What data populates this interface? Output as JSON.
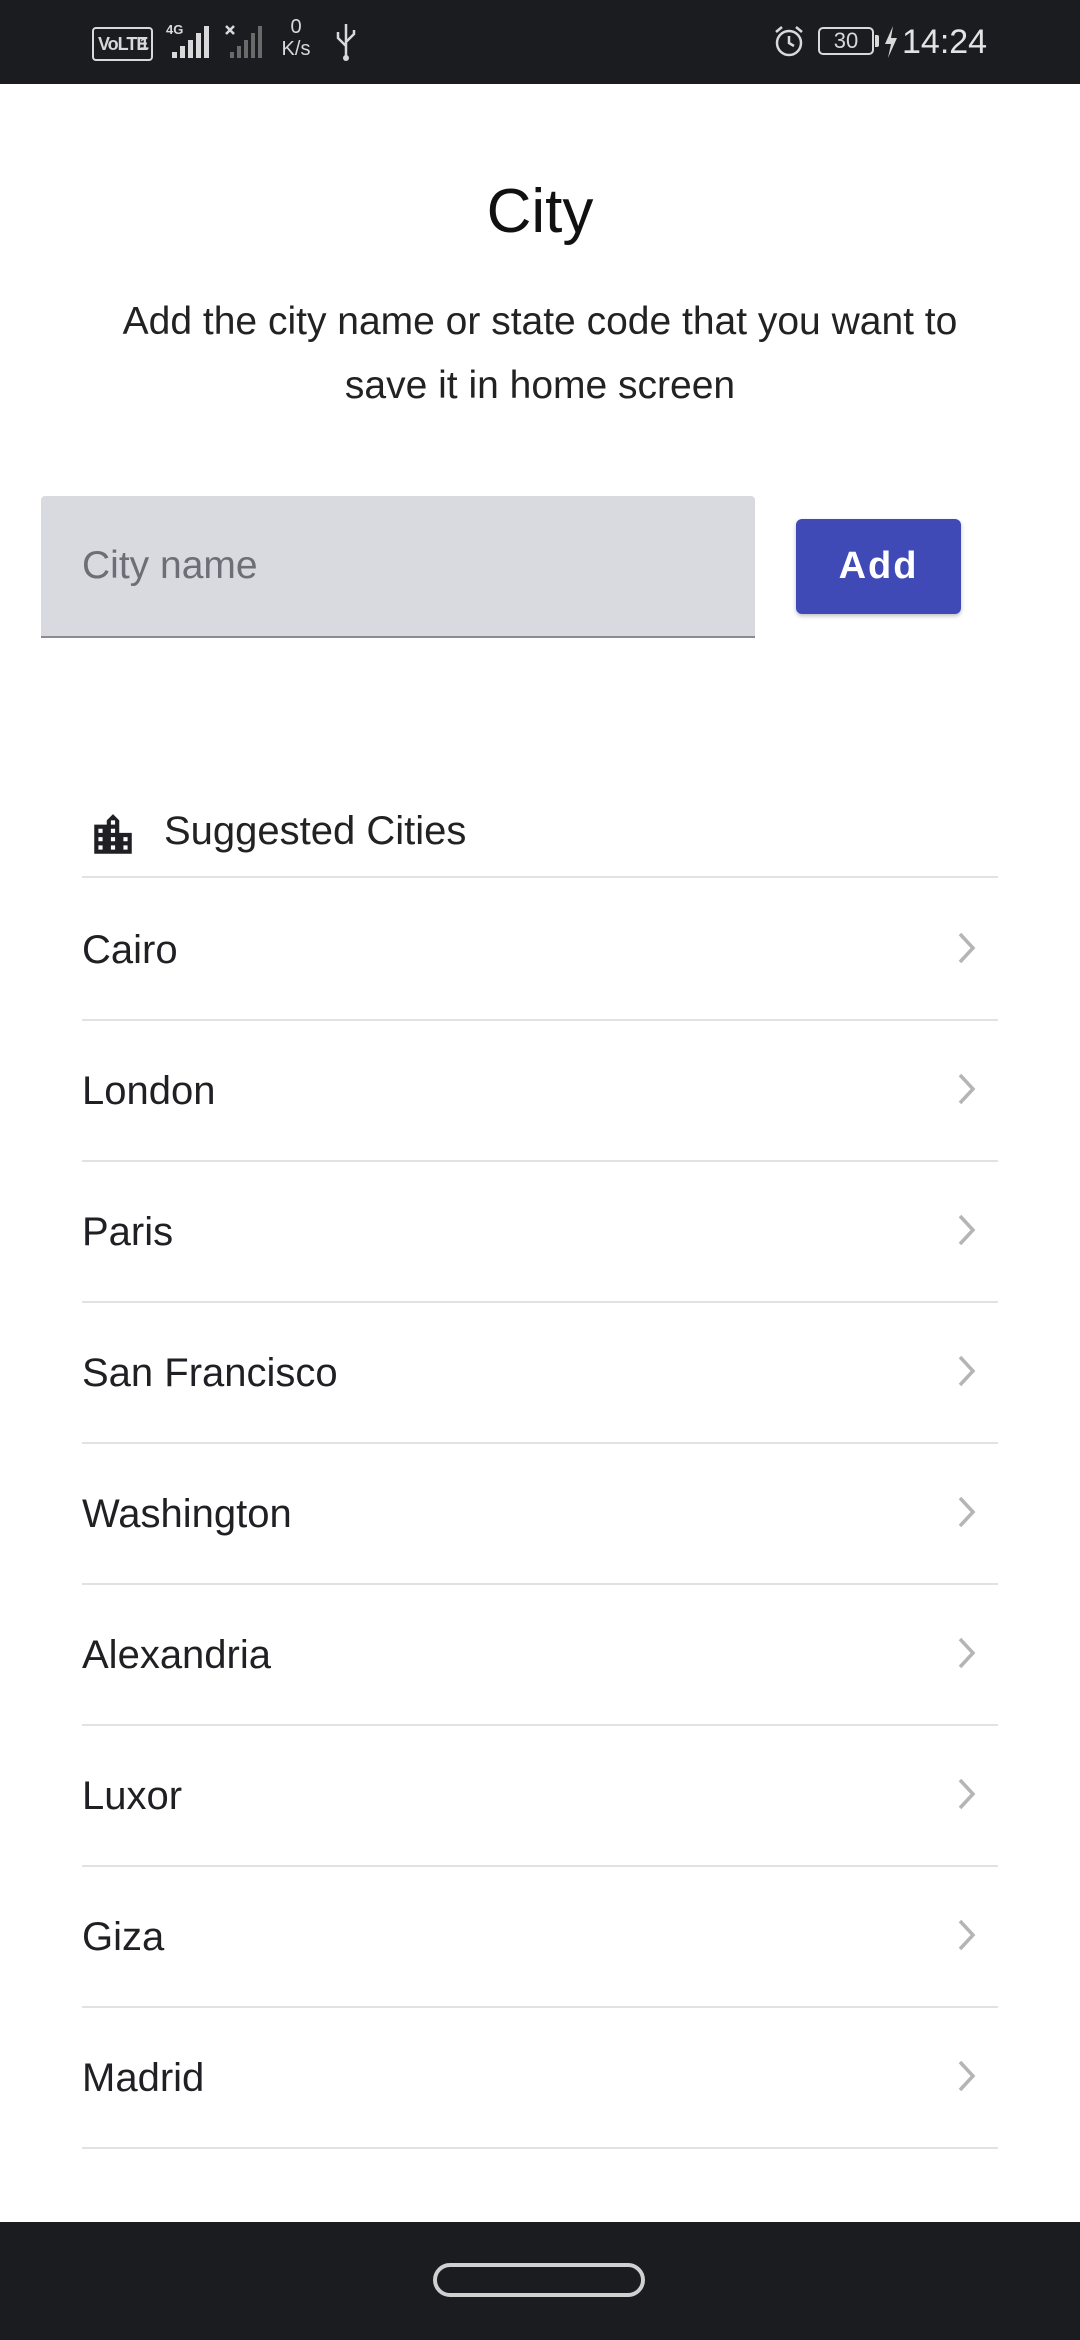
{
  "status_bar": {
    "volte": "VoLTE",
    "volte_sub": "1",
    "network_type": "4G",
    "net_speed_value": "0",
    "net_speed_unit": "K/s",
    "battery": "30",
    "time": "14:24",
    "icons": [
      "signal-icon",
      "no-signal-icon",
      "usb-icon",
      "alarm-icon",
      "battery-icon",
      "charging-icon"
    ]
  },
  "header": {
    "title": "City",
    "subtitle": "Add the city name or state code that you want to save it in home screen"
  },
  "form": {
    "city_placeholder": "City name",
    "city_value": "",
    "add_label": "Add",
    "accent_color": "#3f4ab7"
  },
  "suggested": {
    "icon": "city-icon",
    "title": "Suggested Cities",
    "cities": [
      "Cairo",
      "London",
      "Paris",
      "San Francisco",
      "Washington",
      "Alexandria",
      "Luxor",
      "Giza",
      "Madrid"
    ]
  }
}
